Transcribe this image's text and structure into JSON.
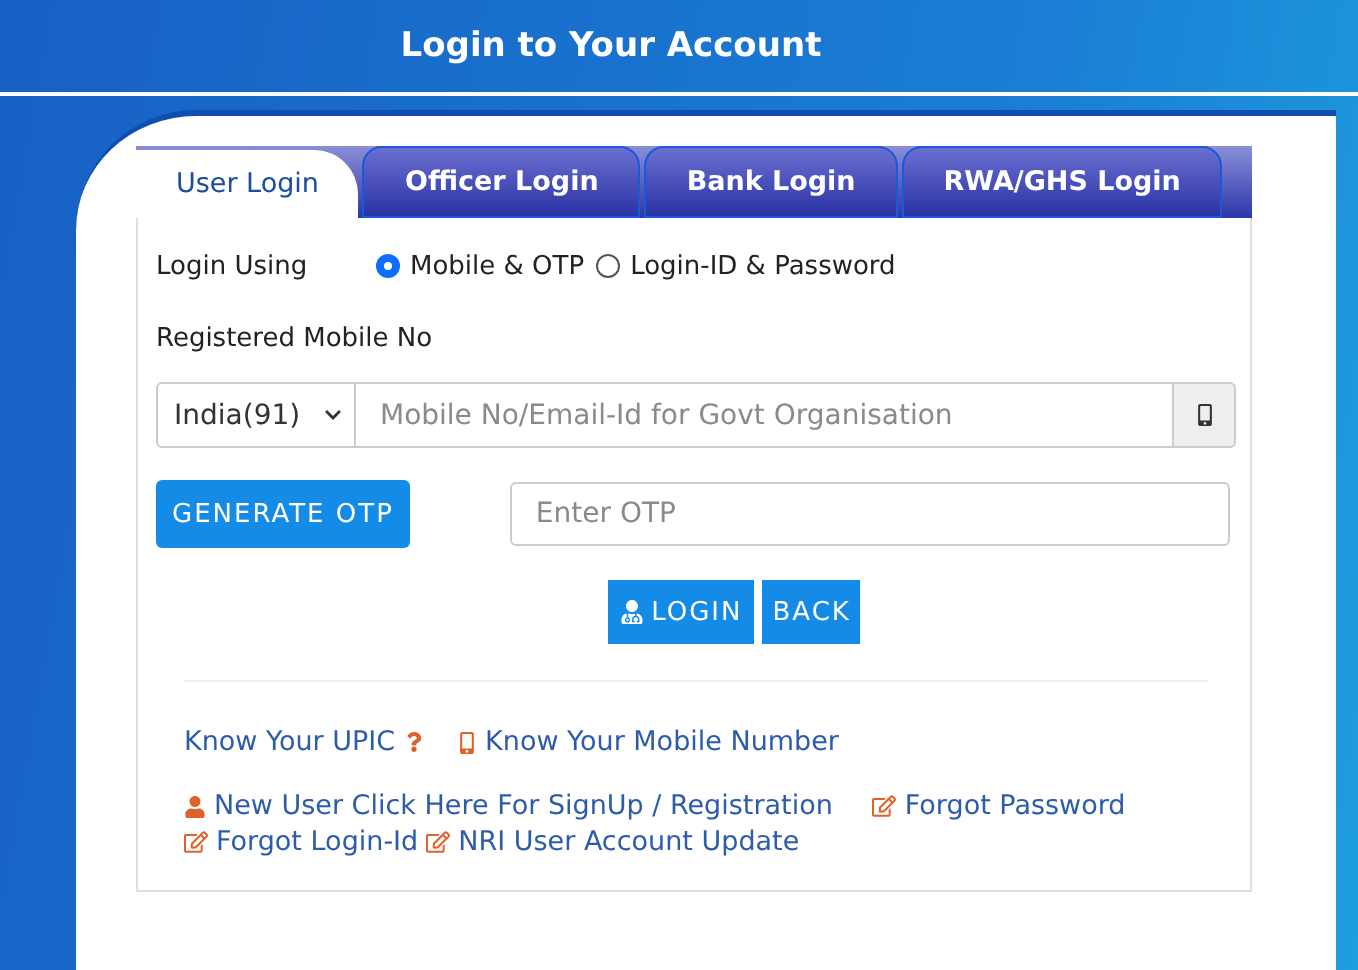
{
  "title": "Login to Your Account",
  "tabs": [
    {
      "label": "User Login",
      "selected": true
    },
    {
      "label": "Officer Login",
      "selected": false
    },
    {
      "label": "Bank Login",
      "selected": false
    },
    {
      "label": "RWA/GHS Login",
      "selected": false
    }
  ],
  "login_using": {
    "label": "Login Using",
    "options": [
      {
        "label": "Mobile & OTP",
        "selected": true
      },
      {
        "label": "Login-ID & Password",
        "selected": false
      }
    ]
  },
  "mobile_label": "Registered Mobile No",
  "country_select": {
    "value": "India(91)"
  },
  "mobile_field": {
    "placeholder": "Mobile No/Email-Id for Govt Organisation"
  },
  "generate_button": "GENERATE OTP",
  "otp_field": {
    "placeholder": "Enter OTP"
  },
  "login_button": "LOGIN",
  "back_button": "BACK",
  "link_rows": [
    [
      {
        "kind": "help",
        "text": "Know Your UPIC"
      },
      {
        "kind": "phone",
        "text": "Know Your Mobile Number"
      }
    ],
    [
      {
        "kind": "signup",
        "text": "New User Click Here For SignUp / Registration"
      },
      {
        "kind": "edit",
        "text": "Forgot Password"
      }
    ],
    [
      {
        "kind": "edit",
        "text": "Forgot Login-Id"
      },
      {
        "kind": "edit",
        "text": "NRI User Account Update"
      }
    ]
  ]
}
